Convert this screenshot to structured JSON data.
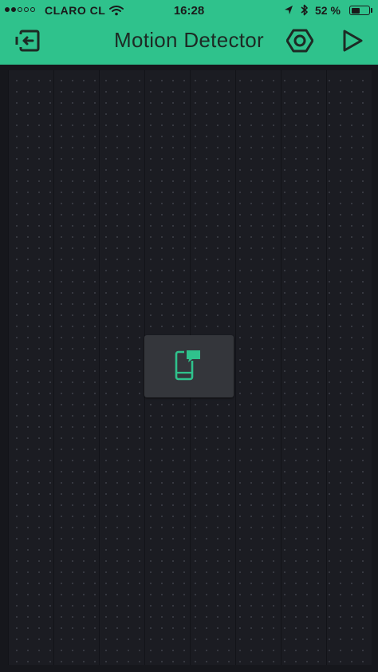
{
  "status_bar": {
    "carrier": "CLARO CL",
    "time": "16:28",
    "battery_percent": "52 %",
    "battery_level": 0.52,
    "signal_bars": 2,
    "signal_total": 5,
    "icons": [
      "signal-dots-icon",
      "wifi-icon",
      "location-arrow-icon",
      "bluetooth-icon",
      "battery-icon"
    ]
  },
  "toolbar": {
    "title": "Motion Detector",
    "icons": [
      "back-exit-icon",
      "settings-hexagon-icon",
      "play-icon"
    ]
  },
  "canvas": {
    "widget": {
      "icon": "phone-notification-icon"
    }
  },
  "colors": {
    "accent": "#2fc28c",
    "background": "#16171c",
    "widget": "#34363b"
  }
}
